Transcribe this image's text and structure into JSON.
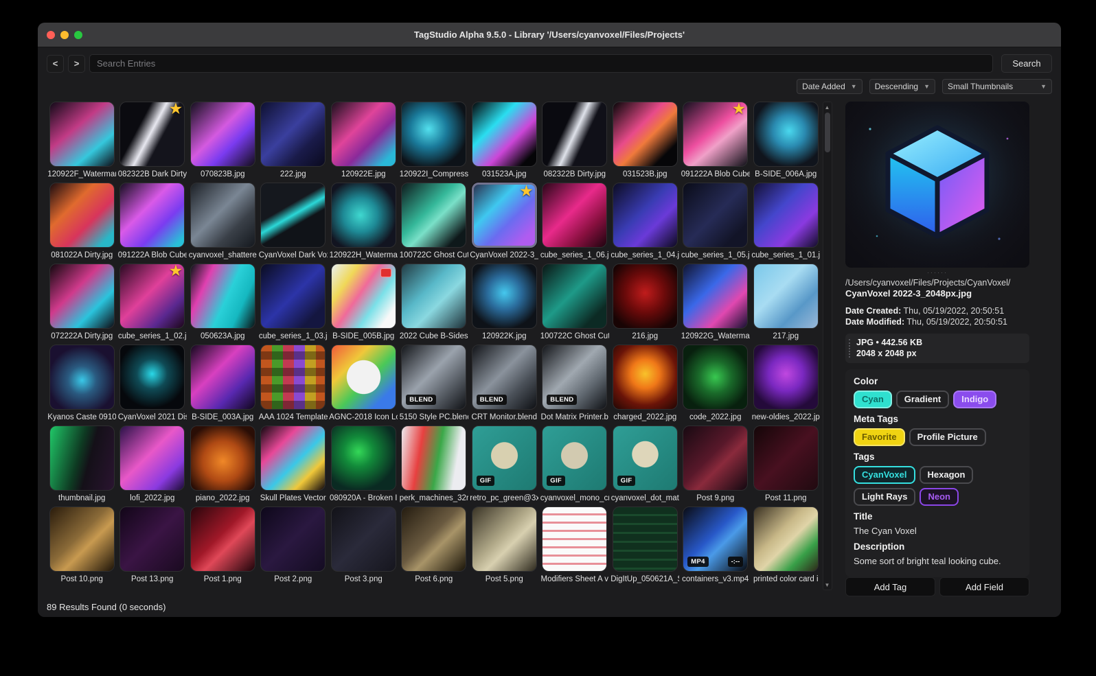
{
  "window": {
    "title": "TagStudio Alpha 9.5.0 - Library '/Users/cyanvoxel/Files/Projects'"
  },
  "toolbar": {
    "back_label": "<",
    "forward_label": ">",
    "search_placeholder": "Search Entries",
    "search_button": "Search"
  },
  "sort": {
    "field": "Date Added",
    "direction": "Descending",
    "thumb_size": "Small Thumbnails"
  },
  "grid": {
    "items": [
      {
        "l": "120922F_Watermarl",
        "g": "linear-gradient(140deg,#120a18,#c23b86 40%,#35c8dd 72%,#0d0d16)"
      },
      {
        "l": "082322B Dark Dirty",
        "g": "linear-gradient(118deg,#0b0b10 32%,#e8e8f0 48%,#14141c 62%)",
        "star": true
      },
      {
        "l": "070823B.jpg",
        "g": "linear-gradient(135deg,#15101e,#d45ae0 45%,#7a3bf0 66%,#120d18)"
      },
      {
        "l": "222.jpg",
        "g": "linear-gradient(135deg,#0e1030,#3a3f9e 45%,#1a1b4a 70%,#0a0a1e)"
      },
      {
        "l": "120922E.jpg",
        "g": "linear-gradient(135deg,#1a0f1c,#e0449a 40%,#8a2a9a 62%,#2ab8d8 88%)"
      },
      {
        "l": "120922I_Compress",
        "g": "radial-gradient(circle at 42% 42%,#53e0ee 0%,#1a7a9a 35%,#0d1218 75%)"
      },
      {
        "l": "031523A.jpg",
        "g": "linear-gradient(135deg,#050507,#2adef0 35%,#cc46d8 62%,#050507 88%)"
      },
      {
        "l": "082322B Dirty.jpg",
        "g": "linear-gradient(115deg,#0a0a10 36%,#dfe2ea 50%,#101018 64%)"
      },
      {
        "l": "031523B.jpg",
        "g": "linear-gradient(135deg,#060608,#e84b8a 40%,#f07a3c 56%,#060608 82%)"
      },
      {
        "l": "091222A Blob Cube",
        "g": "linear-gradient(140deg,#14101e,#ee4fa0 45%,#f0a0c8 60%,#101018)",
        "star": true
      },
      {
        "l": "B-SIDE_006A.jpg",
        "g": "radial-gradient(circle at 55% 45%,#4ad8ee 0%,#2a8ab0 32%,#10141c 72%)"
      },
      {
        "l": "081022A Dirty.jpg",
        "g": "linear-gradient(135deg,#1c0c10,#e06a2e 35%,#d8345c 62%,#28b8c8 88%)"
      },
      {
        "l": "091222A Blob Cube",
        "g": "linear-gradient(135deg,#160e20,#d95ae8 40%,#7a3cf0 66%,#28c0d8 92%)"
      },
      {
        "l": "cyanvoxel_shattere",
        "g": "linear-gradient(135deg,#1c2026,#7a8694 45%,#3a4048 70%,#14181e)"
      },
      {
        "l": "CyanVoxel Dark Vox",
        "g": "linear-gradient(150deg,#15181e 38%,#2bd8d8 50%,#101318 62%)"
      },
      {
        "l": "120922H_Waterma",
        "g": "radial-gradient(circle at 45% 50%,#3fd8d0 0%,#1e8a96 36%,#121420 76%)"
      },
      {
        "l": "100722C Ghost Cut",
        "g": "linear-gradient(135deg,#0e1a1c,#35b89a 42%,#7ae0c8 56%,#0e181a 86%)"
      },
      {
        "l": "CyanVoxel 2022-3_",
        "g": "linear-gradient(135deg,#2b3350,#3fc8f0 35%,#6a6cf0 60%,#b05cf0 86%)",
        "star": true,
        "sel": true
      },
      {
        "l": "cube_series_1_06.j",
        "g": "linear-gradient(135deg,#2a0618,#e82a8a 45%,#8a1040 72%,#1e040f)"
      },
      {
        "l": "cube_series_1_04.j",
        "g": "linear-gradient(135deg,#0c0c22,#3a3cb4 45%,#6a3ad8 66%,#0c0a1e)"
      },
      {
        "l": "cube_series_1_05.j",
        "g": "linear-gradient(135deg,#0a0c18,#262b56 50%,#121427 82%)"
      },
      {
        "l": "cube_series_1_01.j",
        "g": "linear-gradient(135deg,#141036,#4446cc 40%,#8a3ae0 70%,#120d28)"
      },
      {
        "l": "072222A Dirty.jpg",
        "g": "linear-gradient(135deg,#12080e,#d03a8c 40%,#2ac4dd 70%,#0e0a12)"
      },
      {
        "l": "cube_series_1_02.j",
        "g": "linear-gradient(135deg,#2a0a22,#e0409a 45%,#5a2890 75%,#1c0618)",
        "star": true
      },
      {
        "l": "050623A.jpg",
        "g": "linear-gradient(115deg,#0c1418,#e040b0 25%,#2ad0d8 55%,#15b8c0 75%,#0a1012)"
      },
      {
        "l": "cube_series_1_03.j",
        "g": "linear-gradient(135deg,#0a0c20,#2c34a8 50%,#141640 82%)"
      },
      {
        "l": "B-SIDE_005B.jpg",
        "g": "linear-gradient(125deg,#e8f0f4 0%,#f0d858 25%,#f06a9a 45%,#7ae0e8 66%,#f8f8f8 86%)",
        "chip": true
      },
      {
        "l": "2022 Cube B-Sides",
        "g": "linear-gradient(135deg,#223c44,#58b8c8 40%,#8ad8e0 60%,#1c3038)"
      },
      {
        "l": "120922K.jpg",
        "g": "radial-gradient(circle at 50% 45%,#45c8ee 0%,#2a6a9a 36%,#0e1218 76%)"
      },
      {
        "l": "100722C Ghost Cut",
        "g": "linear-gradient(135deg,#0a1614,#1e9a88 46%,#0c2a24 82%)"
      },
      {
        "l": "216.jpg",
        "g": "radial-gradient(circle at 50% 45%,#c01c1c 0%,#6a0a0a 42%,#180404 82%)"
      },
      {
        "l": "120922G_Waterma",
        "g": "linear-gradient(135deg,#101430,#3a68e8 40%,#e048b0 70%,#141030)"
      },
      {
        "l": "217.jpg",
        "g": "linear-gradient(135deg,#7ac8ea,#a8dcf2 40%,#5898c8 70%,#9ab8d8)"
      },
      {
        "l": "Kyanos Caste 0910",
        "g": "radial-gradient(circle at 50% 55%,#3ac8e8 0%,#2a5a80 30%,#1a1030 72%)"
      },
      {
        "l": "CyanVoxel 2021 Dis",
        "g": "radial-gradient(circle at 50% 45%,#2ad8e8 0%,#0f4a55 32%,#06080c 72%)"
      },
      {
        "l": "B-SIDE_003A.jpg",
        "g": "linear-gradient(135deg,#14081e,#d840c0 40%,#5828b0 70%,#10061a)"
      },
      {
        "l": "AAA 1024 Template",
        "g": "repeating-linear-gradient(0deg,rgba(0,0,0,.35) 0 12px,transparent 12px 24px),repeating-linear-gradient(90deg,#c2561e 0 16px,#4a9a2a 16px 32px,#c23a52 32px 48px,#8a4ad0 48px 64px,#c2a022 64px 80px)"
      },
      {
        "l": "AGNC-2018 Icon Lo",
        "g": "radial-gradient(circle at 50% 50%,#f2f2f2 0 37%,rgba(0,0,0,0) 38%),linear-gradient(135deg,#f05a3a,#f0c83a 30%,#4ac858 56%,#3a7ae8 82%)"
      },
      {
        "l": "5150 Style PC.blend",
        "g": "linear-gradient(135deg,#14161a,#9aa2ac 45%,#5a6068 70%,#101216)",
        "b": "BLEND"
      },
      {
        "l": "CRT Monitor.blend",
        "g": "linear-gradient(135deg,#121418,#8a929c 45%,#4a5058 70%,#0e1014)",
        "b": "BLEND"
      },
      {
        "l": "Dot Matrix Printer.b",
        "g": "linear-gradient(135deg,#14161a,#a0a8b0 45%,#606870 70%,#101216)",
        "b": "BLEND"
      },
      {
        "l": "charged_2022.jpg",
        "g": "radial-gradient(circle at 50% 45%,#f8c22a 0%,#f07818 30%,#6a1408 66%,#200604)"
      },
      {
        "l": "code_2022.jpg",
        "g": "radial-gradient(circle at 50% 50%,#38c850 0%,#1a6a2a 36%,#08200e 76%)"
      },
      {
        "l": "new-oldies_2022.jp",
        "g": "radial-gradient(circle at 50% 45%,#c048e0 0%,#7a28c0 36%,#240a3a 76%)"
      },
      {
        "l": "thumbnail.jpg",
        "g": "linear-gradient(105deg,#20c868,#0e3a22 45%,#141018 60%,#2a1430)"
      },
      {
        "l": "lofi_2022.jpg",
        "g": "linear-gradient(135deg,#2a1248,#e858c8 45%,#8a3ae0 76%,#1c0c34)"
      },
      {
        "l": "piano_2022.jpg",
        "g": "radial-gradient(circle at 50% 55%,#f08828 0%,#b04a14 42%,#2a0e06 82%)"
      },
      {
        "l": "Skull Plates Vector",
        "g": "linear-gradient(135deg,#10080e,#e84898 30%,#3ac8e8 56%,#f0c83a 76%,#0e060c)"
      },
      {
        "l": "080920A - Broken I",
        "g": "radial-gradient(circle at 42% 40%,#34d858 0%,#128a3a 28%,#0a2a22 72%)"
      },
      {
        "l": "perk_machines_32r",
        "g": "linear-gradient(100deg,#ececf0,#e84040 30%,#3aa848 56%,#ececf0 82%)"
      },
      {
        "l": "retro_pc_green@3x",
        "g": "radial-gradient(circle at 50% 46%,#d8d0b0 0 28%,rgba(0,0,0,0) 29%),linear-gradient(135deg,#2f9e96,#1e7a72)",
        "b": "GIF"
      },
      {
        "l": "cyanvoxel_mono_cr",
        "g": "radial-gradient(circle at 50% 46%,#d2cab0 0 28%,rgba(0,0,0,0) 29%),linear-gradient(135deg,#2f9e96,#1e7a72)",
        "b": "GIF"
      },
      {
        "l": "cyanvoxel_dot_mat",
        "g": "radial-gradient(circle at 50% 44%,#ded6ba 0 27%,rgba(0,0,0,0) 28%),linear-gradient(135deg,#2f9e96,#1e7a72)",
        "b": "GIF"
      },
      {
        "l": "Post 9.png",
        "g": "linear-gradient(135deg,#180a12,#58182a 45%,#8a2a3c 60%,#120810)"
      },
      {
        "l": "Post 11.png",
        "g": "linear-gradient(135deg,#140608,#481020 50%,#200a10)"
      },
      {
        "l": "Post 10.png",
        "g": "linear-gradient(135deg,#2a1c0c,#8a6a38 45%,#c89a50 60%,#1e1408)"
      },
      {
        "l": "Post 13.png",
        "g": "linear-gradient(135deg,#120618,#3a1444 50%,#1a0a20)"
      },
      {
        "l": "Post 1.png",
        "g": "linear-gradient(135deg,#2a060c,#a01828 45%,#e04858 60%,#1e040a)"
      },
      {
        "l": "Post 2.png",
        "g": "linear-gradient(135deg,#0e081a,#2a1840 50%,#140c22)"
      },
      {
        "l": "Post 3.png",
        "g": "linear-gradient(135deg,#121218,#2a2a3a 50%,#16161e)"
      },
      {
        "l": "Post 6.png",
        "g": "linear-gradient(135deg,#241c10,#6a5a40 45%,#a89468 60%,#1a1408)"
      },
      {
        "l": "Post 5.png",
        "g": "linear-gradient(135deg,#3a3426,#b0a888 45%,#d8d0b0 60%,#2e2a1e)"
      },
      {
        "l": "Modifiers Sheet A v",
        "g": "repeating-linear-gradient(180deg,#fafafa 0 9px,#e89098 9px 12px)"
      },
      {
        "l": "DigItUp_050621A_S",
        "g": "repeating-linear-gradient(180deg,#10301e 0 10px,#1a4a2c 10px 13px)"
      },
      {
        "l": "containers_v3.mp4",
        "g": "linear-gradient(135deg,#0a0c14,#2858c8 45%,#4a9ae8 60%,#080a10)",
        "b": "MP4",
        "time": "-:--"
      },
      {
        "l": "printed color card i",
        "g": "linear-gradient(135deg,#3a3122,#c8b888 40%,#e0d4a8 55%,#38a048 76%,#2e2818)"
      }
    ]
  },
  "scrollbar": {
    "up": "▲",
    "down": "▼"
  },
  "panel": {
    "handle_dots": "······",
    "path_dir": "/Users/cyanvoxel/Files/Projects/CyanVoxel/",
    "file_name": "CyanVoxel 2022-3_2048px.jpg",
    "date_created_label": "Date Created:",
    "date_created": "Thu, 05/19/2022, 20:50:51",
    "date_modified_label": "Date Modified:",
    "date_modified": "Thu, 05/19/2022, 20:50:51",
    "file_info_line1": "JPG  •  442.56 KB",
    "file_info_line2": "2048 x 2048 px",
    "sections": {
      "color_label": "Color",
      "color_tags": [
        {
          "label": "Cyan",
          "bg": "#2fe0cf",
          "fg": "#0b6e66",
          "border": "#84efe4"
        },
        {
          "label": "Gradient",
          "bg": "#1f1f21",
          "fg": "#eeeeee",
          "border": "#4a4a4e"
        },
        {
          "label": "Indigo",
          "bg": "#8a4ced",
          "fg": "#e9d9ff",
          "border": "#a876f5"
        }
      ],
      "meta_label": "Meta Tags",
      "meta_tags": [
        {
          "label": "Favorite",
          "bg": "#f0d312",
          "fg": "#6b5c00",
          "border": "#f7e566"
        },
        {
          "label": "Profile Picture",
          "bg": "#1f1f21",
          "fg": "#eeeeee",
          "border": "#4a4a4e"
        }
      ],
      "tags_label": "Tags",
      "tags": [
        {
          "label": "CyanVoxel",
          "bg": "#10262a",
          "fg": "#35e0e0",
          "border": "#35e0e0"
        },
        {
          "label": "Hexagon",
          "bg": "#1f1f21",
          "fg": "#eeeeee",
          "border": "#4a4a4e"
        },
        {
          "label": "Light Rays",
          "bg": "#1f1f21",
          "fg": "#eeeeee",
          "border": "#4a4a4e"
        },
        {
          "label": "Neon",
          "bg": "#1d1326",
          "fg": "#a65bf2",
          "border": "#8b46e8"
        }
      ],
      "title_label": "Title",
      "title_value": "The Cyan Voxel",
      "desc_label": "Description",
      "desc_value": "Some sort of bright teal looking cube."
    },
    "buttons": {
      "add_tag": "Add Tag",
      "add_field": "Add Field"
    }
  },
  "statusbar": {
    "text": "89 Results Found (0 seconds)"
  }
}
